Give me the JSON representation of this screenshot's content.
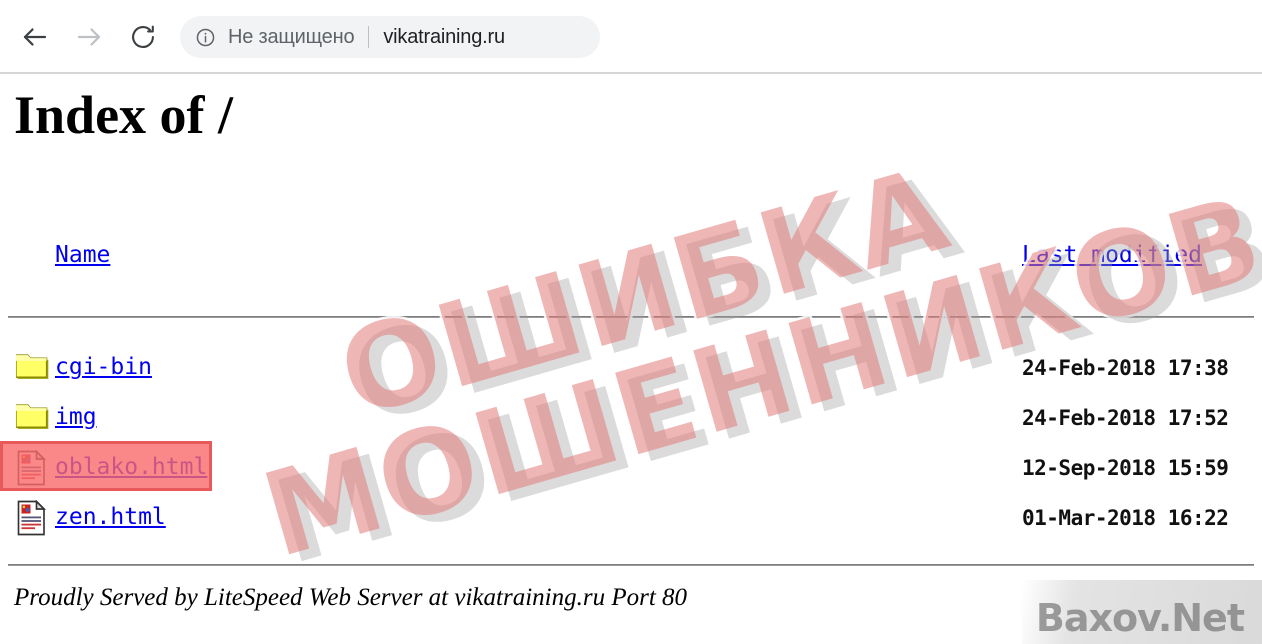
{
  "browser": {
    "back_icon": "arrow-left-icon",
    "forward_icon": "arrow-right-icon",
    "reload_icon": "reload-icon",
    "security_icon": "info-circle-icon",
    "security_label": "Не защищено",
    "url": "vikatraining.ru"
  },
  "page": {
    "title": "Index of /",
    "columns": {
      "name": "Name",
      "last_modified": "Last modified"
    },
    "rows": [
      {
        "icon": "folder-icon",
        "name": "cgi-bin",
        "modified": "24-Feb-2018 17:38",
        "highlighted": false
      },
      {
        "icon": "folder-icon",
        "name": "img",
        "modified": "24-Feb-2018 17:52",
        "highlighted": false
      },
      {
        "icon": "document-icon",
        "name": "oblako.html",
        "modified": "12-Sep-2018 15:59",
        "highlighted": true
      },
      {
        "icon": "document-icon",
        "name": "zen.html",
        "modified": "01-Mar-2018 16:22",
        "highlighted": false
      }
    ],
    "footer": "Proudly Served by LiteSpeed Web Server at vikatraining.ru Port 80"
  },
  "watermark": {
    "line1": "ОШИБКА",
    "line2": "МОШЕННИКОВ",
    "brand": "Baxov.Net"
  },
  "colors": {
    "link": "#0000ee",
    "highlight_fill": "#fb6b6b",
    "highlight_border": "#e53030",
    "watermark_pink": "#e27a7a",
    "folder_yellow": "#ffff66"
  }
}
